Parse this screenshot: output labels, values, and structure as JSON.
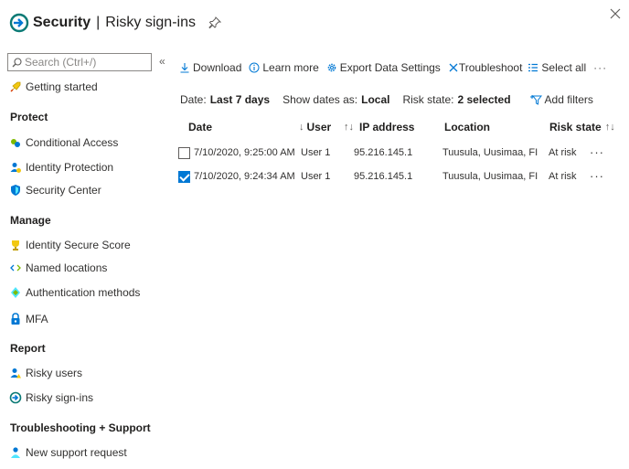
{
  "header": {
    "title": "Security",
    "separator": "|",
    "subtitle": "Risky sign-ins",
    "close": "×"
  },
  "search": {
    "placeholder": "Search (Ctrl+/)",
    "collapse": "«"
  },
  "sidebar": {
    "getting_started": "Getting started",
    "sections": {
      "protect": "Protect",
      "manage": "Manage",
      "report": "Report",
      "troubleshooting": "Troubleshooting + Support"
    },
    "items": {
      "conditional_access": "Conditional Access",
      "identity_protection": "Identity Protection",
      "security_center": "Security Center",
      "identity_secure_score": "Identity Secure Score",
      "named_locations": "Named locations",
      "authentication_methods": "Authentication methods",
      "mfa": "MFA",
      "risky_users": "Risky users",
      "risky_signins": "Risky sign-ins",
      "new_support_request": "New support request"
    }
  },
  "toolbar": {
    "download": "Download",
    "learn_more": "Learn more",
    "export": "Export Data Settings",
    "troubleshoot": "Troubleshoot",
    "select_all": "Select all",
    "more": "···"
  },
  "filters": {
    "date_label": "Date:",
    "date_value": "Last 7 days",
    "show_dates_label": "Show dates as:",
    "show_dates_value": "Local",
    "risk_state_label": "Risk state:",
    "risk_state_value": "2 selected",
    "add_filters": "Add filters"
  },
  "table": {
    "columns": {
      "date": "Date",
      "user": "User",
      "ip": "IP address",
      "location": "Location",
      "risk_state": "Risk state"
    },
    "sort_down": "↓",
    "sort_both": "↑↓",
    "rows": [
      {
        "checked": false,
        "date": "7/10/2020, 9:25:00 AM",
        "user": "User 1",
        "ip": "95.216.145.1",
        "location": "Tuusula, Uusimaa, FI",
        "risk": "At risk",
        "more": "···"
      },
      {
        "checked": true,
        "date": "7/10/2020, 9:24:34 AM",
        "user": "User 1",
        "ip": "95.216.145.1",
        "location": "Tuusula, Uusimaa, FI",
        "risk": "At risk",
        "more": "···"
      }
    ]
  },
  "colors": {
    "accent": "#0078d4",
    "text": "#323130"
  }
}
